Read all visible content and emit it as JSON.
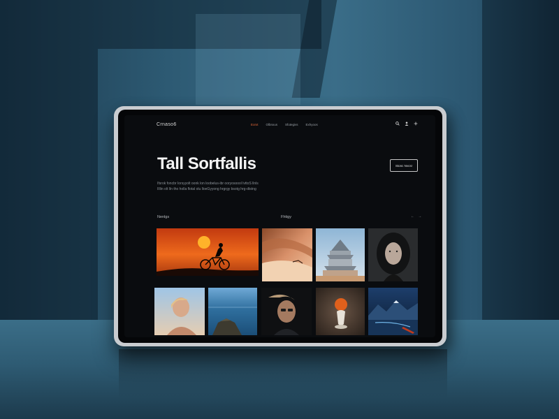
{
  "app": {
    "logo": "Crnaso6"
  },
  "nav": {
    "links": [
      {
        "label": "Eorxt",
        "active": true
      },
      {
        "label": "Olbnxus",
        "active": false
      },
      {
        "label": "Sfutegivs",
        "active": false
      },
      {
        "label": "Exhyoos",
        "active": false
      }
    ],
    "icons": [
      "search-icon",
      "user-icon",
      "plus-icon"
    ]
  },
  "hero": {
    "title": "Tall Sortfallis",
    "button_label": "Stonc Nvcsr",
    "description_lines": [
      "Ifsrok foncbr Iorsyyolt oonk lon loobelus-ibr ooryosoool lvttoS llnls",
      "Illlin olt lIn tho holla flotal olu lloeGyyong hrgrgy bsotg hrg-dtstng"
    ]
  },
  "gallery": {
    "section_left": "Nenlgs",
    "section_right": "Fhtigy",
    "arrows": "← →",
    "tiles": [
      {
        "subject": "cyclist silhouette at sunset"
      },
      {
        "subject": "desert sand dunes"
      },
      {
        "subject": "pagoda temple"
      },
      {
        "subject": "portrait woman curly hair"
      },
      {
        "subject": "portrait blonde woman"
      },
      {
        "subject": "ocean cliff coast"
      },
      {
        "subject": "portrait man windswept hair"
      },
      {
        "subject": "orange sphere sculpture"
      },
      {
        "subject": "mountain lake night"
      }
    ]
  },
  "colors": {
    "screen_bg": "#0a0c0f",
    "accent": "#e86a3a",
    "tablet_frame": "#c9ccd0"
  }
}
